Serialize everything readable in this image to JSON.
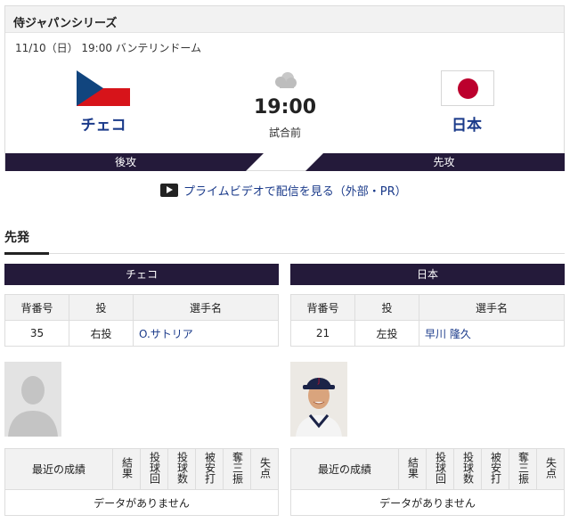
{
  "header": {
    "title": "侍ジャパンシリーズ"
  },
  "game": {
    "info": "11/10（日） 19:00 バンテリンドーム",
    "time": "19:00",
    "status": "試合前",
    "weather_icon": "cloud-icon"
  },
  "home": {
    "name": "チェコ",
    "batting": "後攻",
    "flag": "czech-flag"
  },
  "away": {
    "name": "日本",
    "batting": "先攻",
    "flag": "japan-flag"
  },
  "prime_link": "プライムビデオで配信を見る（外部・PR）",
  "section_title": "先発",
  "pitcher_headers": [
    "背番号",
    "投",
    "選手名"
  ],
  "record_headers": [
    "最近の成績",
    "結果",
    "投球回",
    "投球数",
    "被安打",
    "奪三振",
    "失点"
  ],
  "no_data": "データがありません",
  "left_panel": {
    "team": "チェコ",
    "number": "35",
    "throws": "右投",
    "name": "O.サトリア"
  },
  "right_panel": {
    "team": "日本",
    "number": "21",
    "throws": "左投",
    "name": "早川 隆久"
  },
  "colors": {
    "navy": "#241a3a",
    "link": "#1a3a8a",
    "czech_red": "#d7141a",
    "czech_blue": "#11457e",
    "japan_red": "#bc002d"
  }
}
